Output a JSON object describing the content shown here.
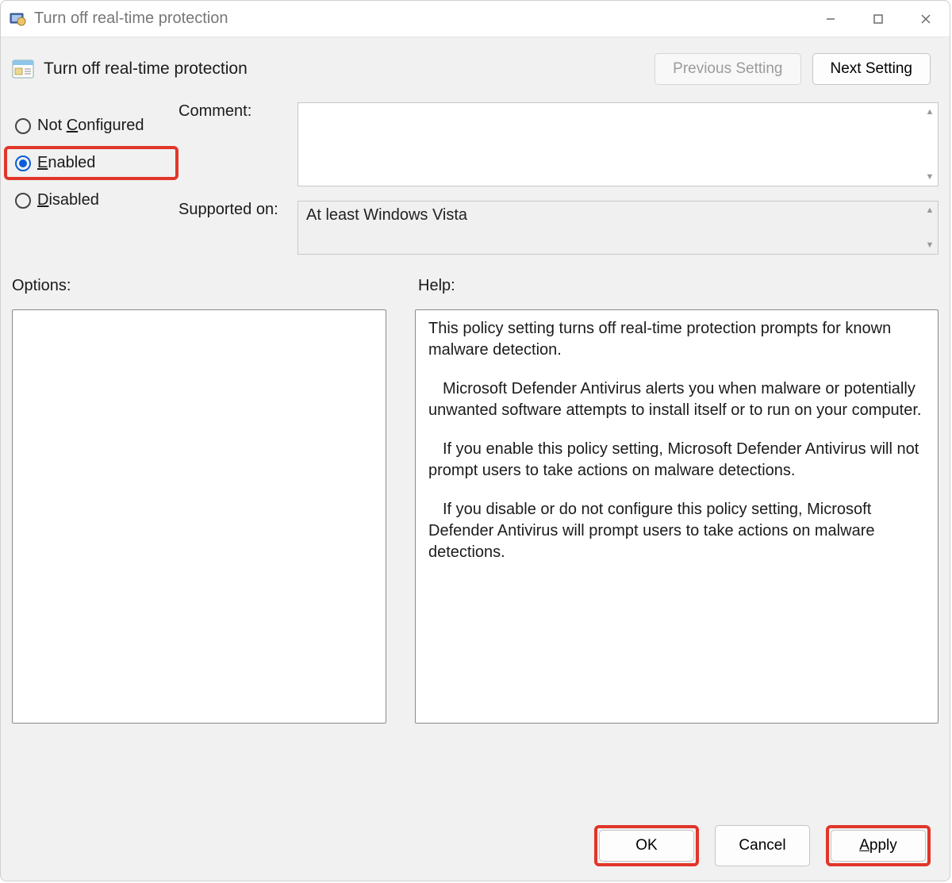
{
  "window": {
    "title": "Turn off real-time protection"
  },
  "header": {
    "policy_title": "Turn off real-time protection",
    "prev_button": "Previous Setting",
    "next_button": "Next Setting"
  },
  "radios": {
    "not_configured": "Not Configured",
    "enabled": "Enabled",
    "disabled": "Disabled",
    "selected": "enabled"
  },
  "fields": {
    "comment_label": "Comment:",
    "comment_value": "",
    "supported_label": "Supported on:",
    "supported_value": "At least Windows Vista"
  },
  "sections": {
    "options_label": "Options:",
    "help_label": "Help:"
  },
  "help": {
    "p1": "This policy setting turns off real-time protection prompts for known malware detection.",
    "p2": "Microsoft Defender Antivirus alerts you when malware or potentially unwanted software attempts to install itself or to run on your computer.",
    "p3": "If you enable this policy setting, Microsoft Defender Antivirus will not prompt users to take actions on malware detections.",
    "p4": "If you disable or do not configure this policy setting, Microsoft Defender Antivirus will prompt users to take actions on malware detections."
  },
  "footer": {
    "ok": "OK",
    "cancel": "Cancel",
    "apply": "Apply"
  }
}
